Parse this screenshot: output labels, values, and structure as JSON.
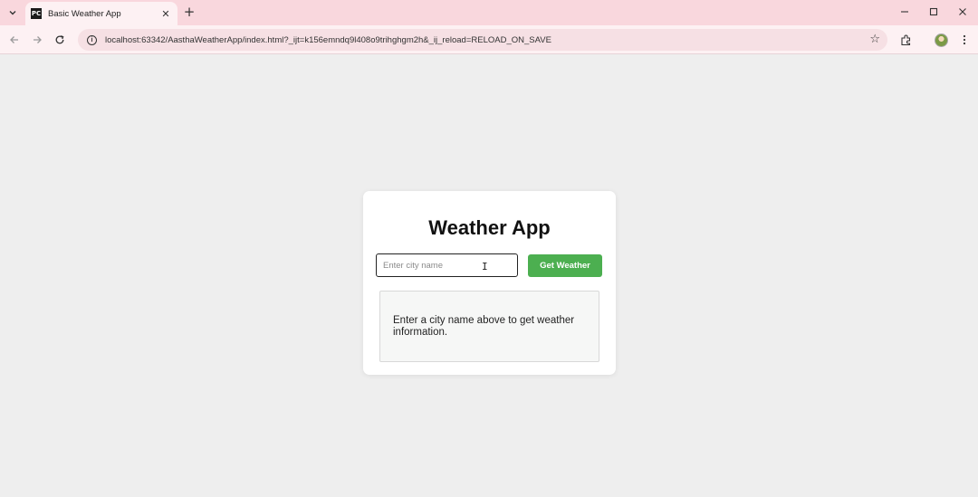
{
  "browser": {
    "tab": {
      "favicon_text": "PC",
      "title": "Basic Weather App",
      "close_glyph": "✕"
    },
    "new_tab_glyph": "+",
    "window_controls": {
      "minimize": "—",
      "maximize": "☐",
      "close": "✕"
    },
    "url": "localhost:63342/AasthaWeatherApp/index.html?_ijt=k156emndq9l408o9trihghgm2h&_ij_reload=RELOAD_ON_SAVE",
    "icons": [
      "tab-search-icon",
      "back-arrow-icon",
      "forward-arrow-icon",
      "reload-icon",
      "info-icon",
      "star-icon",
      "extensions-icon",
      "profile-avatar",
      "kebab-menu-icon"
    ]
  },
  "app": {
    "title": "Weather App",
    "search": {
      "placeholder": "Enter city name",
      "value": ""
    },
    "button_label": "Get Weather",
    "result_text": "Enter a city name above to get weather information.",
    "colors": {
      "button": "#4caf50",
      "card": "#ffffff",
      "background": "#eeeeee"
    }
  }
}
